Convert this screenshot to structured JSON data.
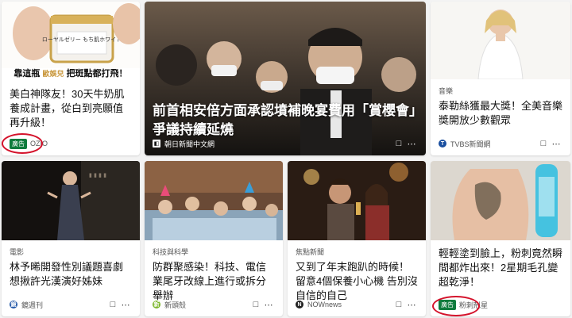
{
  "cards": [
    {
      "overlay_left": "靠這瓶",
      "overlay_mid": "歐娛兒",
      "overlay_right": "把斑點都打飛！",
      "product_text": "ローヤルゼリー もち肌ホワイト",
      "title": "美白神隊友！30天牛奶肌養成計畫，從白到亮願值再升級！",
      "ad_label": "廣告",
      "source": "OZIO"
    },
    {
      "title": "前首相安倍方面承認墳補晚宴費用「賞櫻會」爭議持續延燒",
      "source": "朝日新聞中文網"
    },
    {
      "category": "音樂",
      "title": "泰勒絲獲最大獎！全美音樂獎開放少數觀眾",
      "source": "TVBS新聞網"
    },
    {
      "category": "電影",
      "title": "林予晞開發性別議題喜劇 想揪許光漢演好姊妹",
      "source": "鏡週刊"
    },
    {
      "category": "科技與科學",
      "title": "防群聚感染！科技、電信業尾牙改線上進行或拆分舉辦",
      "source": "新頭殼"
    },
    {
      "category": "焦點新聞",
      "title": "又到了年末跑趴的時候！留意4個保養小心機 告別沒自信的自己",
      "source": "NOWnews"
    },
    {
      "title": "輕輕塗到臉上，粉刺竟然瞬間都炸出來！2星期毛孔變超乾淨！",
      "ad_label": "廣告",
      "source": "粉刺剋星"
    }
  ],
  "icons": {
    "save": "bookmark-icon",
    "more": "more-icon"
  },
  "colors": {
    "ad_badge": "#0f7b3d",
    "annotation_ring": "#d4122b",
    "emphasis_red": "#e21b2c"
  }
}
